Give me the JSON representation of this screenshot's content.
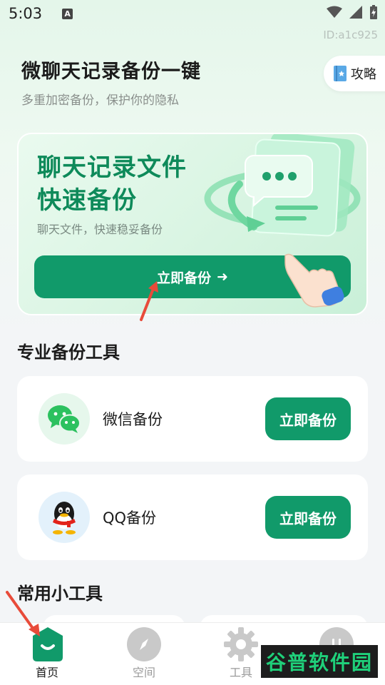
{
  "status_bar": {
    "time": "5:03",
    "notification_glyph": "A"
  },
  "user_id": "ID:a1c925",
  "header": {
    "title": "微聊天记录备份一键",
    "subtitle": "多重加密备份，保护你的隐私",
    "guide_label": "攻略"
  },
  "hero": {
    "title_line1": "聊天记录文件",
    "title_line2": "快速备份",
    "subtitle": "聊天文件，快速稳妥备份",
    "button_label": "立即备份",
    "button_arrow": "➜"
  },
  "pro_tools": {
    "title": "专业备份工具",
    "items": [
      {
        "name": "微信备份",
        "button_label": "立即备份",
        "icon": "wechat-icon"
      },
      {
        "name": "QQ备份",
        "button_label": "立即备份",
        "icon": "qq-icon"
      }
    ]
  },
  "common_tools": {
    "title": "常用小工具"
  },
  "bottom_nav": {
    "items": [
      {
        "label": "首页",
        "icon": "home-icon",
        "active": true
      },
      {
        "label": "空间",
        "icon": "compass-icon",
        "active": false
      },
      {
        "label": "工具",
        "icon": "gear-icon",
        "active": false
      },
      {
        "label": "",
        "icon": "profile-icon",
        "active": false
      }
    ]
  },
  "watermark": {
    "text": "谷普软件园"
  },
  "colors": {
    "primary": "#119a6a",
    "hero_title": "#0e8a5a",
    "background": "#f3f5f7",
    "annotation_arrow": "#e84b3a"
  }
}
